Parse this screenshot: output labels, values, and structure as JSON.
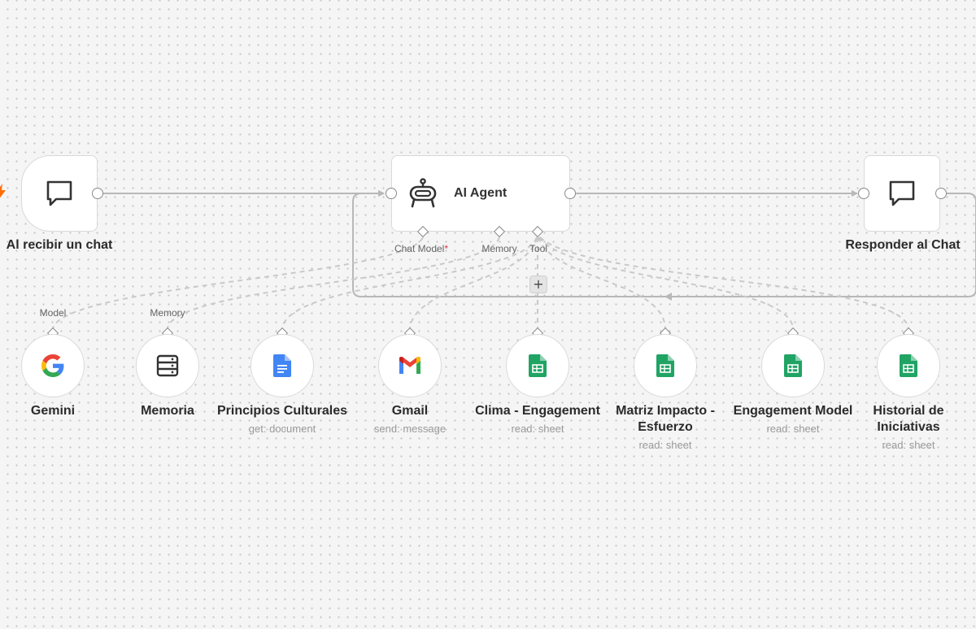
{
  "workflow": {
    "nodes": {
      "trigger": {
        "label": "Al recibir un chat",
        "icon": "chat-bubble-icon"
      },
      "agent": {
        "label": "AI Agent",
        "icon": "robot-icon",
        "ports": {
          "chat_model": "Chat Model",
          "chat_model_required": "*",
          "memory": "Memory",
          "tool": "Tool"
        },
        "add_tool": "+"
      },
      "respond": {
        "label": "Responder al Chat",
        "icon": "chat-bubble-icon"
      }
    },
    "subnodes": [
      {
        "label": "Gemini",
        "line2": "",
        "subtitle": "",
        "icon": "google-icon",
        "port_label": "Model"
      },
      {
        "label": "Memoria",
        "line2": "",
        "subtitle": "",
        "icon": "database-icon",
        "port_label": "Memory"
      },
      {
        "label": "Principios Culturales",
        "line2": "",
        "subtitle": "get: document",
        "icon": "google-docs-icon",
        "port_label": ""
      },
      {
        "label": "Gmail",
        "line2": "",
        "subtitle": "send: message",
        "icon": "gmail-icon",
        "port_label": ""
      },
      {
        "label": "Clima - Engagement",
        "line2": "",
        "subtitle": "read: sheet",
        "icon": "google-sheets-icon",
        "port_label": ""
      },
      {
        "label": "Matriz Impacto -",
        "line2": "Esfuerzo",
        "subtitle": "read: sheet",
        "icon": "google-sheets-icon",
        "port_label": ""
      },
      {
        "label": "Engagement Model",
        "line2": "",
        "subtitle": "read: sheet",
        "icon": "google-sheets-icon",
        "port_label": ""
      },
      {
        "label": "Historial de",
        "line2": "Iniciativas",
        "subtitle": "read: sheet",
        "icon": "google-sheets-icon",
        "port_label": ""
      }
    ]
  },
  "colors": {
    "canvas": "#f5f5f5",
    "edge": "#b8b8b8",
    "trigger_bolt": "#ff6d00",
    "required_marker": "#e0323c",
    "sheets_green": "#20a464",
    "docs_blue": "#4285f4"
  }
}
